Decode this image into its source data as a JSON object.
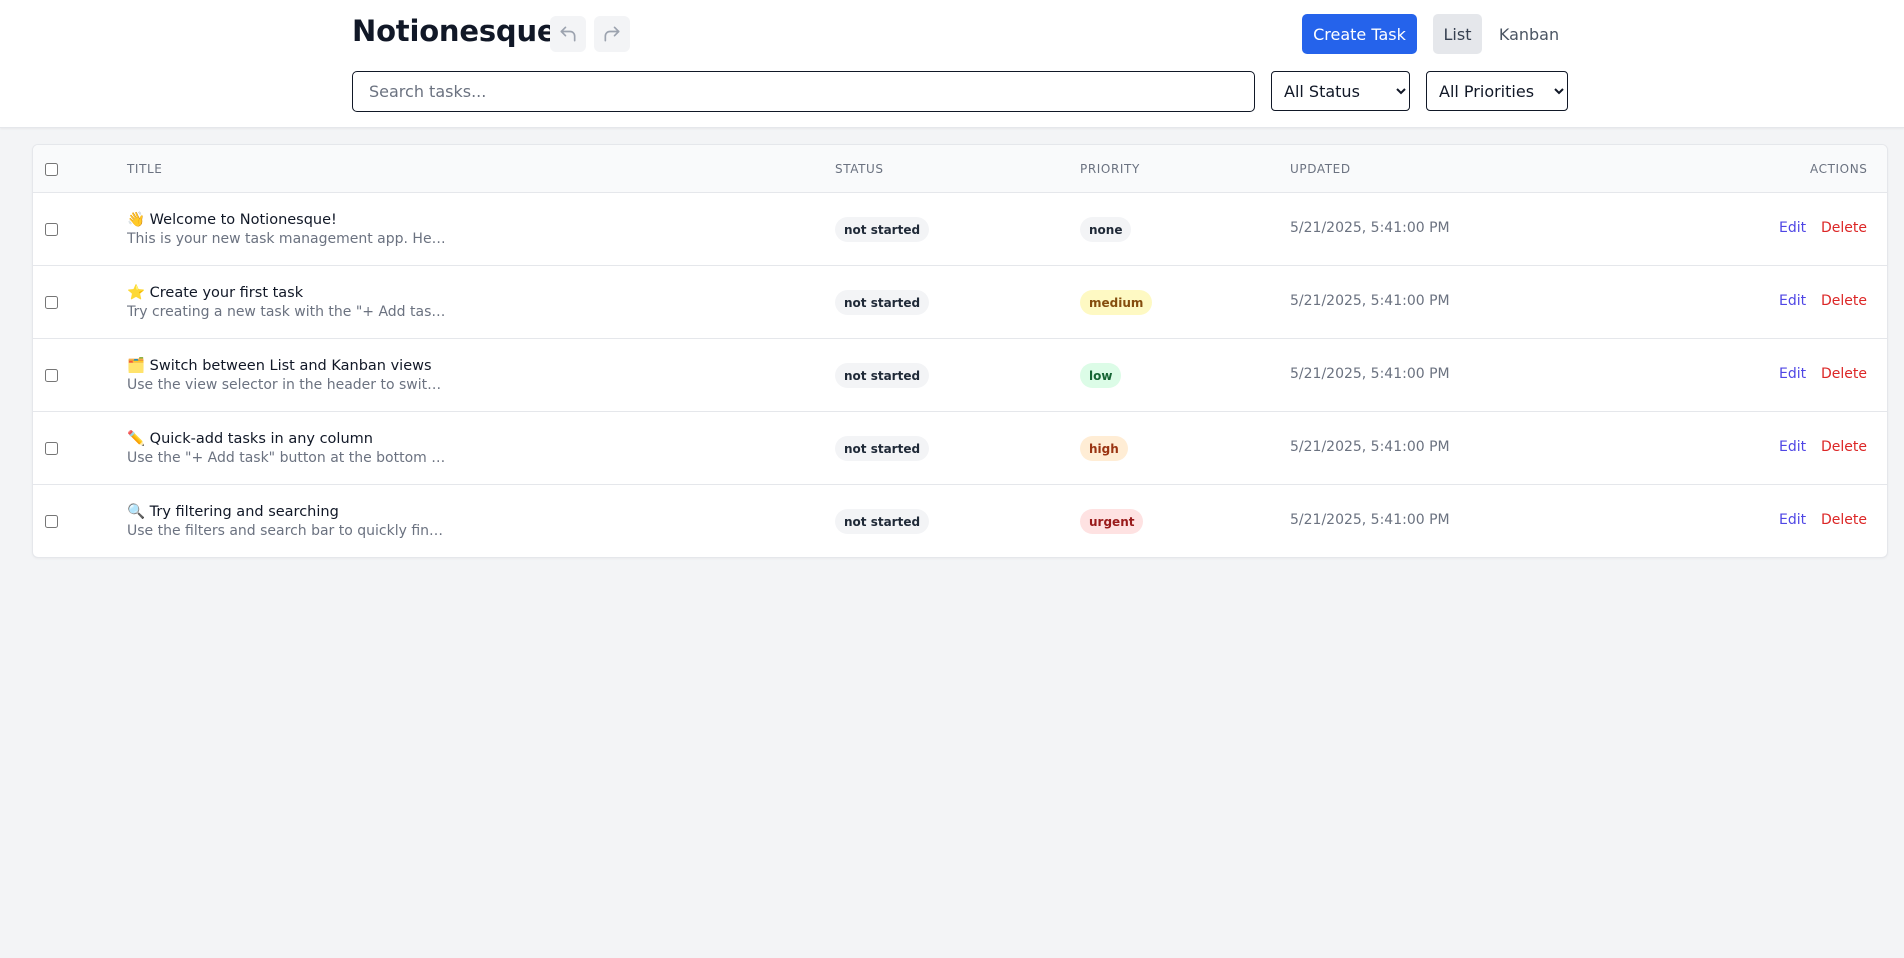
{
  "header": {
    "title": "Notionesque",
    "create_label": "Create Task",
    "views": [
      "List",
      "Kanban"
    ],
    "active_view": "List",
    "search_placeholder": "Search tasks...",
    "status_filter": "All Status",
    "priority_filter": "All Priorities"
  },
  "table": {
    "columns": {
      "title": "Title",
      "status": "Status",
      "priority": "Priority",
      "updated": "Updated",
      "actions": "Actions"
    },
    "edit_label": "Edit",
    "delete_label": "Delete",
    "rows": [
      {
        "title": "👋 Welcome to Notionesque!",
        "desc": "This is your new task management app. Here are …",
        "status": "not started",
        "priority": "none",
        "updated": "5/21/2025, 5:41:00 PM"
      },
      {
        "title": "⭐ Create your first task",
        "desc": "Try creating a new task with the \"+ Add task\" but…",
        "status": "not started",
        "priority": "medium",
        "updated": "5/21/2025, 5:41:00 PM"
      },
      {
        "title": "🗂️ Switch between List and Kanban views",
        "desc": "Use the view selector in the header to switch bet…",
        "status": "not started",
        "priority": "low",
        "updated": "5/21/2025, 5:41:00 PM"
      },
      {
        "title": "✏️ Quick-add tasks in any column",
        "desc": "Use the \"+ Add task\" button at the bottom of an…",
        "status": "not started",
        "priority": "high",
        "updated": "5/21/2025, 5:41:00 PM"
      },
      {
        "title": "🔍 Try filtering and searching",
        "desc": "Use the filters and search bar to quickly find the …",
        "status": "not started",
        "priority": "urgent",
        "updated": "5/21/2025, 5:41:00 PM"
      }
    ]
  },
  "colors": {
    "primary": "#2563eb",
    "edit": "#4f46e5",
    "delete": "#dc2626",
    "background": "#f3f4f6"
  }
}
